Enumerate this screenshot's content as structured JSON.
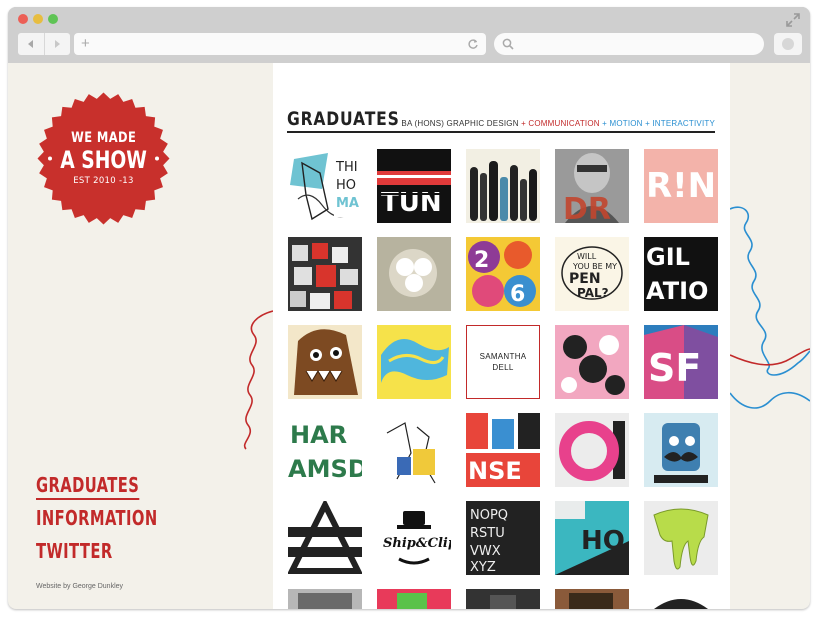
{
  "browser": {
    "icons": [
      "back-arrow-icon",
      "forward-arrow-icon",
      "plus-icon",
      "reload-icon",
      "search-icon",
      "fullscreen-icon"
    ]
  },
  "badge": {
    "line1": "WE MADE",
    "line2": "A SHOW",
    "line3": "EST 2010 -13",
    "color": "#c8302c"
  },
  "nav": {
    "items": [
      {
        "label": "GRADUATES",
        "active": true
      },
      {
        "label": "INFORMATION",
        "active": false
      },
      {
        "label": "TWITTER",
        "active": false
      }
    ]
  },
  "credit": "Website by George Dunkley",
  "header": {
    "title": "GRADUATES",
    "subtitle_prefix": "BA (HONS) GRAPHIC DESIGN",
    "subtitle_sep1": " + ",
    "subtitle_red": "COMMUNICATION",
    "subtitle_sep2": " + ",
    "subtitle_blue": "MOTION + INTERACTIVITY"
  },
  "grid": {
    "rows": [
      [
        "tile-fox-illustration",
        "tile-tun-typography",
        "tile-bottles-silhouette",
        "tile-portrait-dr",
        "tile-rinf-type"
      ],
      [
        "tile-red-keys",
        "tile-lamp-product",
        "tile-colorful-numbers",
        "tile-penpal-lettering",
        "tile-bw-letters"
      ],
      [
        "tile-brown-monster",
        "tile-yellow-blue-type",
        "tile-samantha-dell",
        "tile-pink-pattern",
        "tile-3d-letters"
      ],
      [
        "tile-green-type",
        "tile-sketch-figures",
        "tile-sense-type",
        "tile-pink-ring",
        "tile-mustache-character"
      ],
      [
        "tile-triangle-mark",
        "tile-ship-clip-logo",
        "tile-alphabet-grid",
        "tile-teal-magazine",
        "tile-green-slime"
      ]
    ],
    "featured_label_line1": "SAMANTHA",
    "featured_label_line2": "DELL"
  },
  "colors": {
    "accent_red": "#c22a2a",
    "accent_blue": "#2a8fd1",
    "sidebar_bg": "#f3f1ea"
  }
}
